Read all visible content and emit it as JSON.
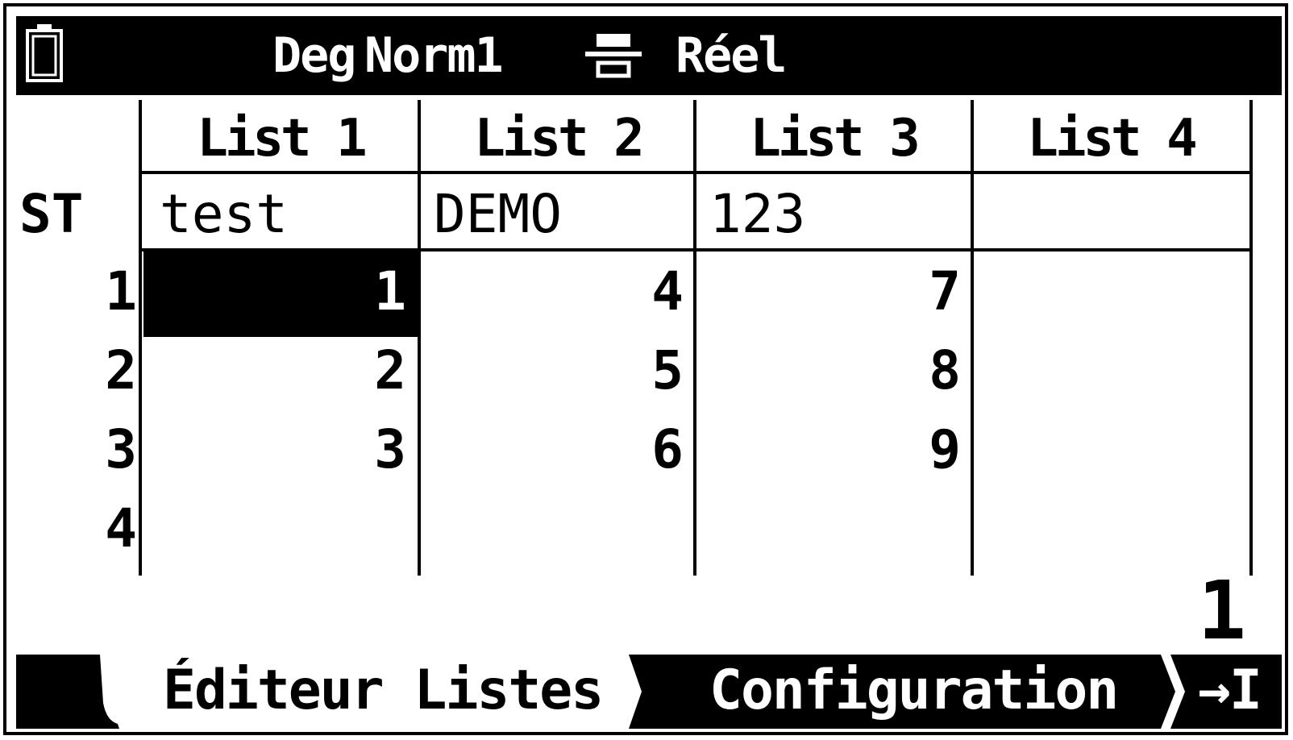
{
  "status": {
    "angle": "Deg",
    "display": "Norm1",
    "mode": "Réel"
  },
  "lists": {
    "headers": [
      "List 1",
      "List 2",
      "List 3",
      "List 4"
    ],
    "st_label": "ST",
    "st_values": [
      "test",
      "DEMO",
      "123",
      ""
    ],
    "row_numbers": [
      "1",
      "2",
      "3",
      "4"
    ],
    "columns": [
      [
        "1",
        "2",
        "3",
        ""
      ],
      [
        "4",
        "5",
        "6",
        ""
      ],
      [
        "7",
        "8",
        "9",
        ""
      ],
      [
        "",
        "",
        "",
        ""
      ]
    ]
  },
  "cursor_value": "1",
  "menu": {
    "tab1": "Éditeur Listes",
    "tab2": "Configuration",
    "end_icon": "→I"
  },
  "icons": {
    "battery": "battery-icon",
    "display": "display-format-icon"
  }
}
